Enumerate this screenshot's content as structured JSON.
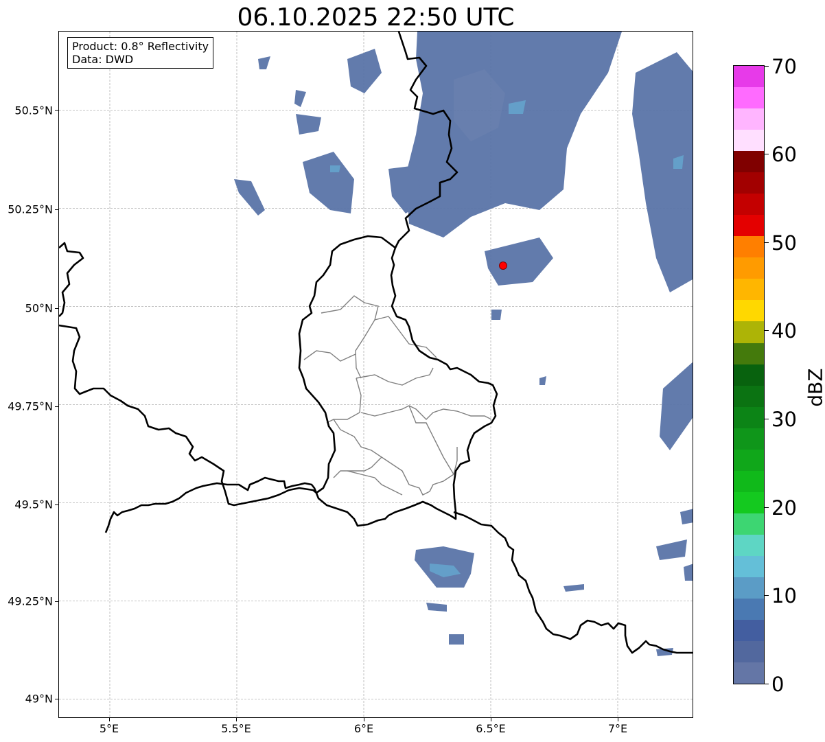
{
  "title": "06.10.2025 22:50 UTC",
  "info": {
    "product": "Product: 0.8° Reflectivity",
    "source": "Data: DWD"
  },
  "axes": {
    "x_ticks": [
      "5°E",
      "5.5°E",
      "6°E",
      "6.5°E",
      "7°E"
    ],
    "y_ticks": [
      "50.5°N",
      "50.25°N",
      "50°N",
      "49.75°N",
      "49.5°N",
      "49.25°N",
      "49°N"
    ],
    "x_range": [
      4.8,
      7.3
    ],
    "y_range": [
      48.95,
      50.7
    ]
  },
  "colorbar": {
    "label": "dBZ",
    "ticks": [
      "0",
      "10",
      "20",
      "30",
      "40",
      "50",
      "60",
      "70"
    ],
    "range": [
      0,
      70
    ],
    "step": 2.5,
    "colors": [
      "#6476a6",
      "#52689e",
      "#435ea0",
      "#4a79b2",
      "#5b9cc6",
      "#64bfd8",
      "#5ed6c4",
      "#3dd672",
      "#14c91f",
      "#10b91a",
      "#10a71a",
      "#0f961a",
      "#0c8416",
      "#0b7312",
      "#08620e",
      "#447a0c",
      "#adb406",
      "#ffd800",
      "#ffb600",
      "#ff9b00",
      "#ff7f00",
      "#e40000",
      "#c40000",
      "#a20000",
      "#800000",
      "#ffdfff",
      "#ffb5ff",
      "#ff6bff",
      "#e73ae9"
    ]
  },
  "station": {
    "name": "radar-site",
    "lon": 6.55,
    "lat": 50.11,
    "color": "#ff0000"
  },
  "colors": {
    "echo": "#5a74a8",
    "echo_light": "#65a3cc",
    "border": "#000000",
    "admin": "#808080",
    "grid": "#b0b0b0"
  }
}
